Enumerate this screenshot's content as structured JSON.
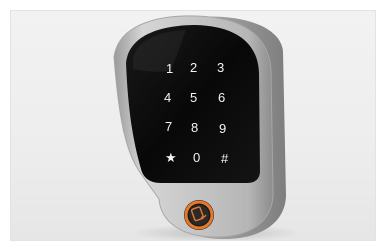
{
  "photo": {
    "subject": "keypad-access-control-reader",
    "colors": {
      "background": "#efefef",
      "housing": "#c9c9c9",
      "panel": "#0c0c0c",
      "key_text": "#f4f4f4",
      "reader_ring": "#e8792a"
    }
  },
  "keypad": {
    "keys": [
      "1",
      "2",
      "3",
      "4",
      "5",
      "6",
      "7",
      "8",
      "9",
      "★",
      "0",
      "#"
    ]
  }
}
